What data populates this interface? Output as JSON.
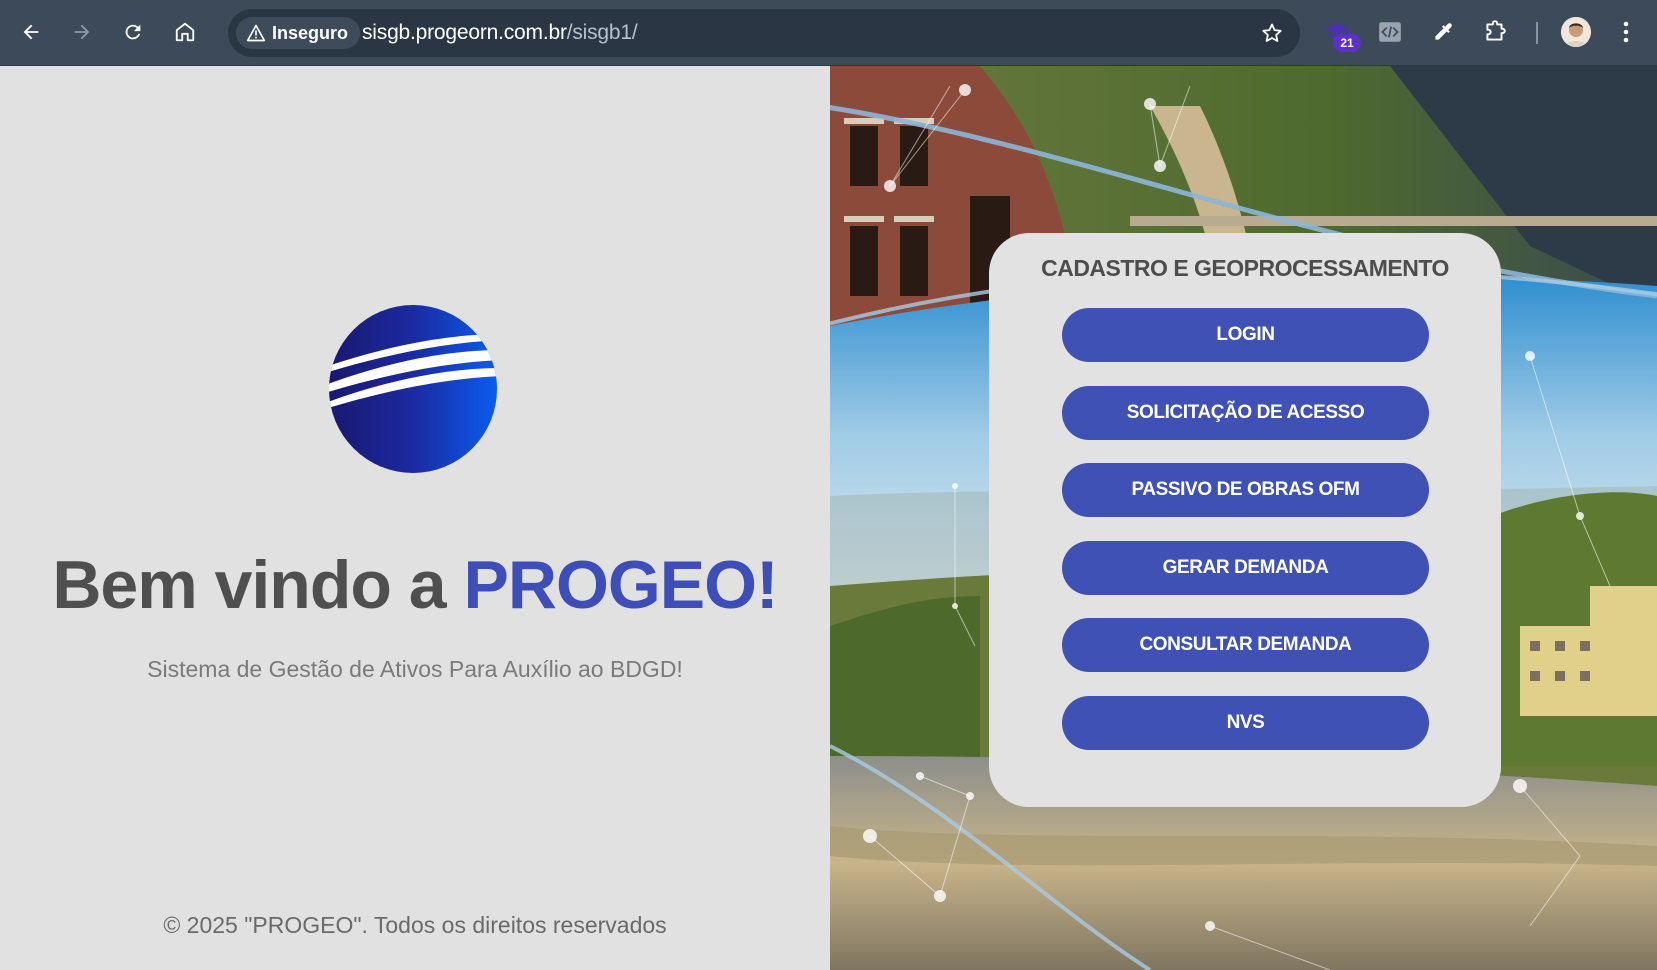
{
  "browser": {
    "security_label": "Inseguro",
    "url_host": "sisgb.progeorn.com.br",
    "url_path": "/sisgb1/",
    "extension_badge": "21"
  },
  "welcome": {
    "prefix": "Bem vindo a ",
    "brand": "PROGEO!",
    "subtitle": "Sistema de Gestão de Ativos Para Auxílio ao BDGD!"
  },
  "footer": {
    "text": "© 2025 \"PROGEO\". Todos os direitos reservados"
  },
  "menu": {
    "title": "CADASTRO E GEOPROCESSAMENTO",
    "buttons": [
      {
        "label": "LOGIN"
      },
      {
        "label": "SOLICITAÇÃO DE ACESSO"
      },
      {
        "label": "PASSIVO DE OBRAS OFM"
      },
      {
        "label": "GERAR DEMANDA"
      },
      {
        "label": "CONSULTAR DEMANDA"
      },
      {
        "label": "NVS"
      }
    ]
  },
  "colors": {
    "brand_blue": "#3d4eb8",
    "button_blue": "#3f51b5",
    "chrome_bg": "#3c4a5a",
    "page_bg": "#e1e1e1"
  }
}
